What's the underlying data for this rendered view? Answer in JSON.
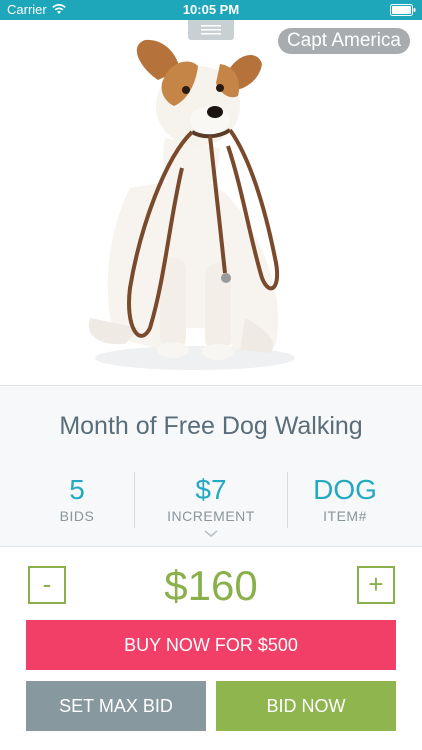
{
  "status_bar": {
    "carrier": "Carrier",
    "time": "10:05 PM",
    "wifi_icon": "wifi-icon",
    "battery_icon": "battery-icon",
    "background_color": "#1ea6ba"
  },
  "hero": {
    "user_badge": "Capt America",
    "photo_subject": "jack-russell-dog-with-leash"
  },
  "item": {
    "title": "Month of Free Dog Walking",
    "stats": [
      {
        "value": "5",
        "label": "BIDS"
      },
      {
        "value": "$7",
        "label": "INCREMENT"
      },
      {
        "value": "DOG",
        "label": "ITEM#"
      }
    ]
  },
  "bidding": {
    "decrement_label": "-",
    "increment_label": "+",
    "current_bid": "$160",
    "buy_now_label": "BUY NOW FOR $500",
    "max_bid_label": "SET MAX BID",
    "bid_now_label": "BID NOW"
  },
  "colors": {
    "accent_teal": "#24a9c2",
    "accent_green": "#8ab04b",
    "buy_now_pink": "#f13f68",
    "max_bid_gray": "#87989f"
  }
}
